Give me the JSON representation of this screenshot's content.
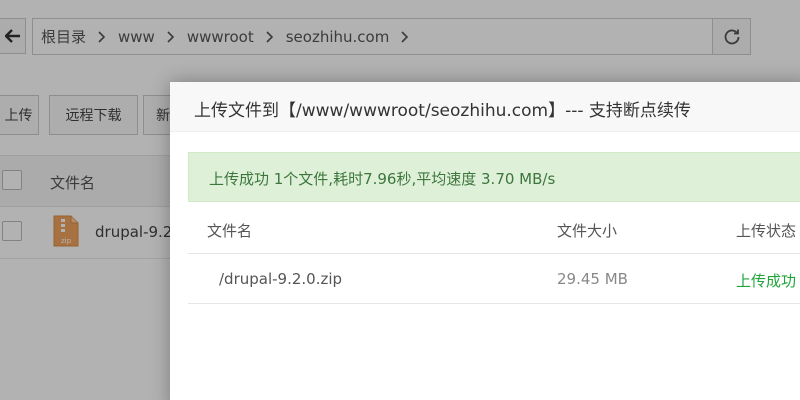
{
  "breadcrumb": [
    "根目录",
    "www",
    "wwwroot",
    "seozhihu.com"
  ],
  "toolbar": {
    "upload_label": "上传",
    "remote_download_label": "远程下载",
    "new_label": "新"
  },
  "file_table": {
    "column_name": "文件名",
    "rows": [
      {
        "name": "drupal-9.2"
      }
    ]
  },
  "modal": {
    "title": "上传文件到【/www/wwwroot/seozhihu.com】--- 支持断点续传",
    "alert": "上传成功 1个文件,耗时7.96秒,平均速度 3.70 MB/s",
    "columns": [
      "文件名",
      "文件大小",
      "上传状态"
    ],
    "rows": [
      {
        "name": "/drupal-9.2.0.zip",
        "size": "29.45 MB",
        "status": "上传成功"
      }
    ]
  },
  "colors": {
    "success_text": "#20a53a",
    "alert_bg": "#dff0d8",
    "alert_text": "#3c763d"
  }
}
